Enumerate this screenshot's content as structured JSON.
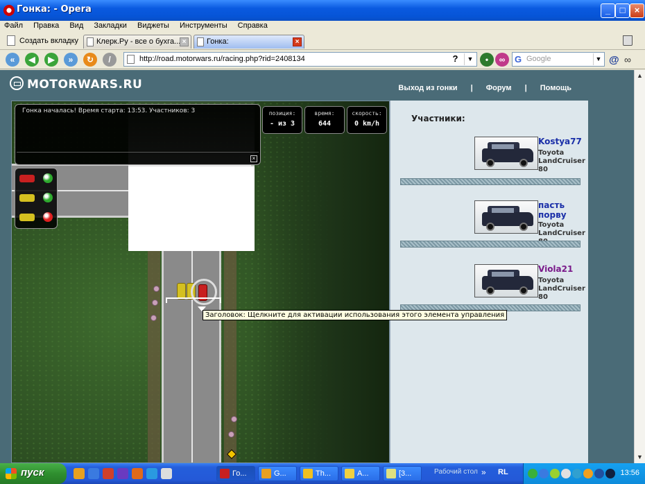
{
  "window": {
    "title": "Гонка: - Opera",
    "min": "_",
    "max": "□",
    "close": "×"
  },
  "menu": [
    "Файл",
    "Правка",
    "Вид",
    "Закладки",
    "Виджеты",
    "Инструменты",
    "Справка"
  ],
  "tabs": {
    "new_tab": "Создать вкладку",
    "items": [
      {
        "label": "Клерк.Ру - все о бухга...",
        "active": false
      },
      {
        "label": "Гонка:",
        "active": true
      }
    ]
  },
  "toolbar": {
    "address": "http://road.motorwars.ru/racing.php?rid=2408134",
    "help": "?",
    "search_placeholder": "Google",
    "search_engine": "G"
  },
  "site": {
    "logo": "MOTORWARS.RU",
    "nav": [
      "Выход из гонки",
      "|",
      "Форум",
      "|",
      "Помощь"
    ]
  },
  "game": {
    "message": "Гонка началась! Время старта: 13:53. Участников: 3",
    "position_label": "позиция:",
    "position_value": "- из 3",
    "time_label": "время:",
    "time_value": "644",
    "speed_label": "скорость:",
    "speed_value": "0 km/h",
    "lights": [
      {
        "car_color": "#c82020",
        "bulb_color": "#2eaa2e"
      },
      {
        "car_color": "#d4c020",
        "bulb_color": "#2eaa2e"
      },
      {
        "car_color": "#d4c020",
        "bulb_color": "#e02020"
      }
    ],
    "tooltip": "Заголовок: Щелкните для активации использования этого элемента управления"
  },
  "panel": {
    "title": "Участники:",
    "participants": [
      {
        "name": "Kostya77",
        "name_color": "#1a2fa8",
        "model": "Toyota LandCruiser 80"
      },
      {
        "name": "пасть порву",
        "name_color": "#1a2fa8",
        "model": "Toyota LandCruiser 80"
      },
      {
        "name": "Viola21",
        "name_color": "#7a1a8a",
        "model": "Toyota LandCruiser 80"
      }
    ]
  },
  "taskbar": {
    "start": "пуск",
    "tasks": [
      {
        "label": "Го...",
        "active": true
      },
      {
        "label": "G...",
        "active": false
      },
      {
        "label": "Th...",
        "active": false
      },
      {
        "label": "A...",
        "active": false
      },
      {
        "label": "[3...",
        "active": false
      }
    ],
    "desktop_label": "Рабочий стол",
    "lang": "RL",
    "clock": "13:56"
  }
}
